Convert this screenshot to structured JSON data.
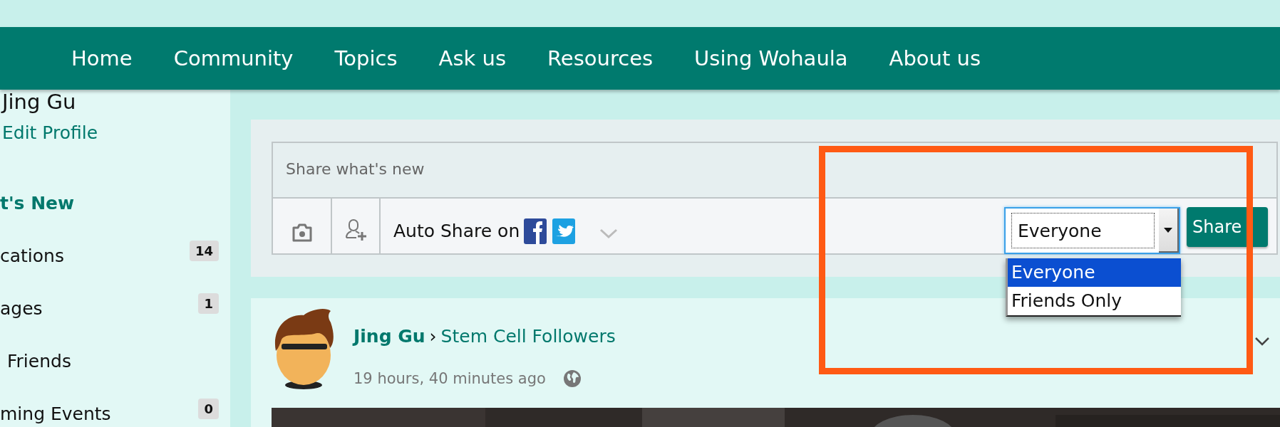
{
  "nav": {
    "items": [
      {
        "label": "Home"
      },
      {
        "label": "Community"
      },
      {
        "label": "Topics"
      },
      {
        "label": "Ask us"
      },
      {
        "label": "Resources"
      },
      {
        "label": "Using Wohaula"
      },
      {
        "label": "About us"
      }
    ]
  },
  "sidebar": {
    "profile_name": "Jing Gu",
    "edit_link": "Edit Profile",
    "items": [
      {
        "label": "t's New",
        "selected": true
      },
      {
        "label": "cations",
        "selected": false,
        "badge": "14"
      },
      {
        "label": "ages",
        "selected": false,
        "badge": "1"
      },
      {
        "label": "Friends",
        "selected": false
      },
      {
        "label": "ming Events",
        "selected": false,
        "badge": "0"
      }
    ]
  },
  "composer": {
    "placeholder": "Share what's new",
    "auto_share_label": "Auto Share on",
    "audience": {
      "value": "Everyone",
      "open": true,
      "options": [
        {
          "label": "Everyone",
          "selected": true
        },
        {
          "label": "Friends Only",
          "selected": false
        }
      ]
    },
    "share_button": "Share"
  },
  "post": {
    "author": "Jing Gu",
    "separator": "›",
    "group": "Stem Cell Followers",
    "time": "19 hours, 40 minutes ago"
  }
}
